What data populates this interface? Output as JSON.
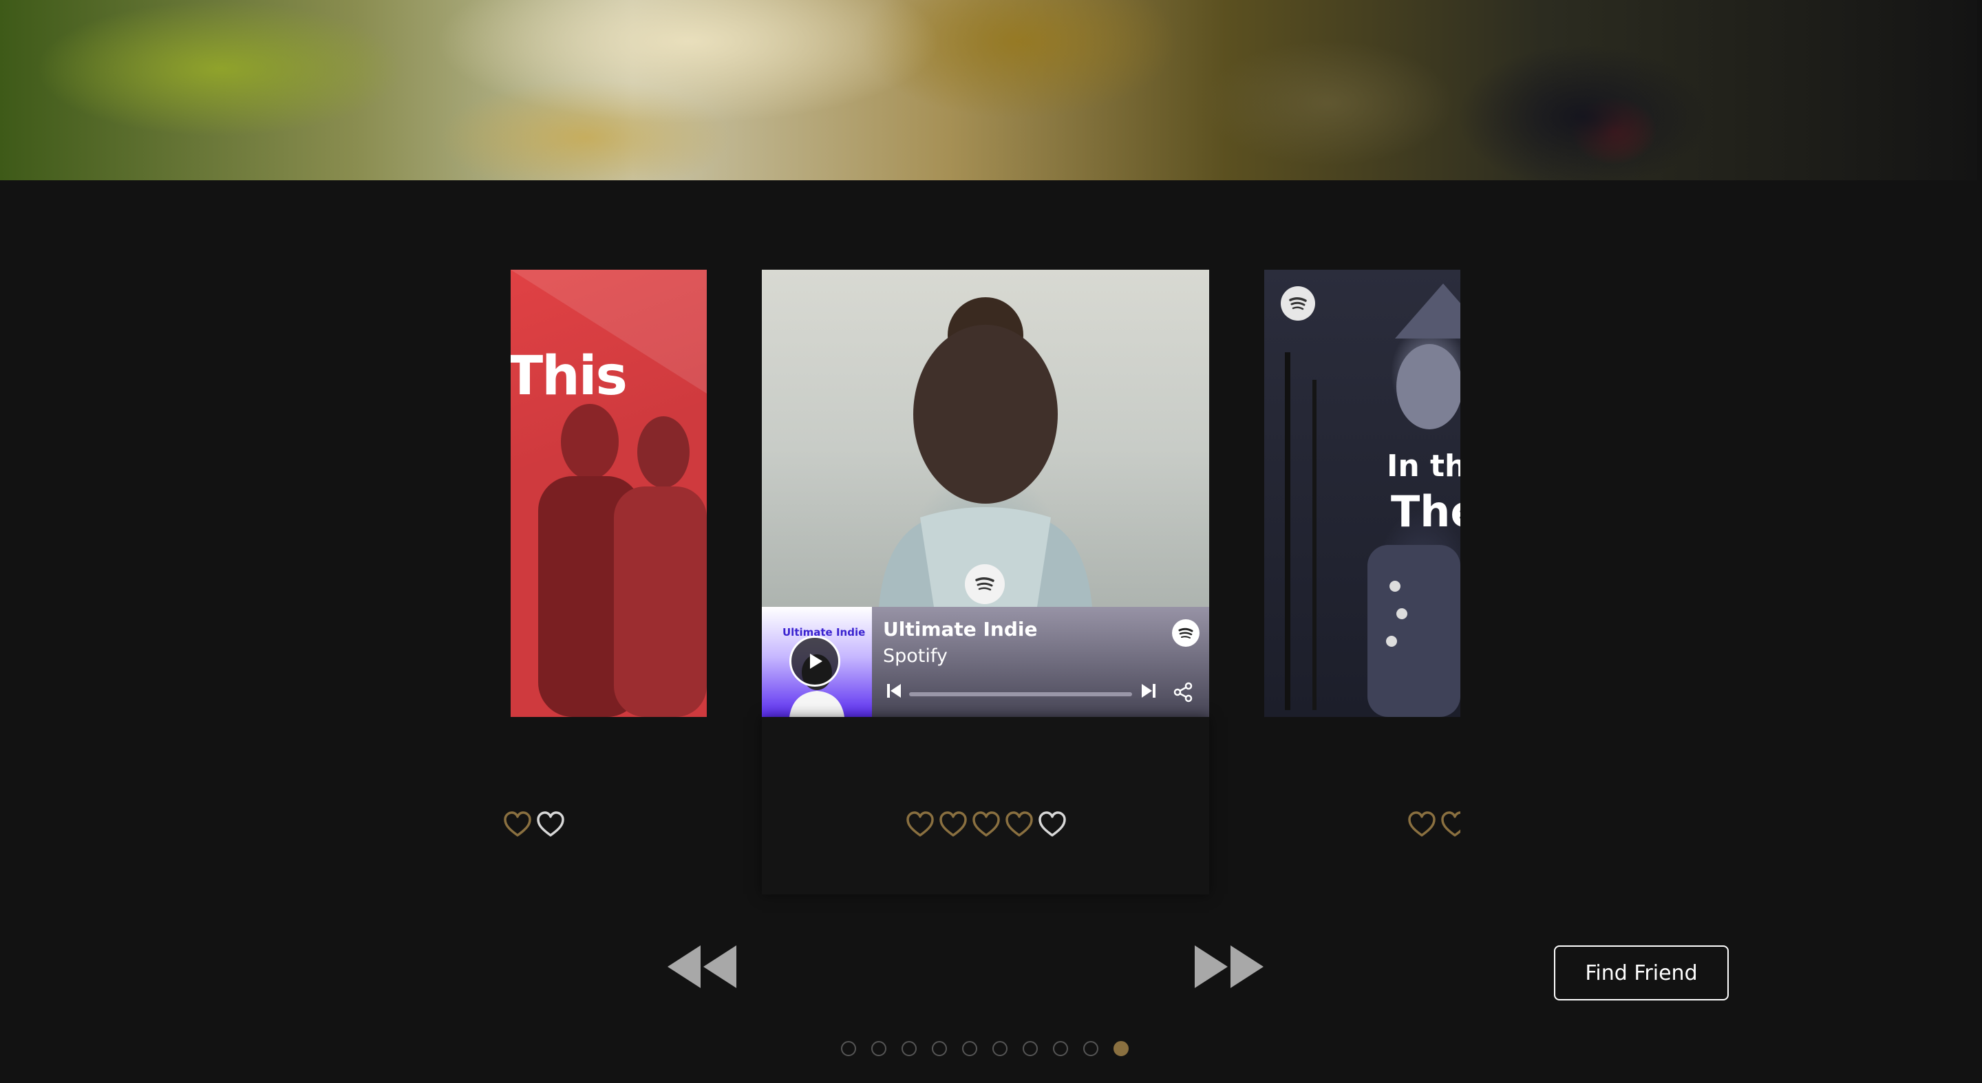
{
  "carousel": {
    "left_card": {
      "title_fragment": "This"
    },
    "center_card": {
      "cover_title": "Ultimate Indie",
      "track_title": "Ultimate Indie",
      "track_artist": "Spotify",
      "progress": 0
    },
    "right_card": {
      "line1": "In the",
      "line2": "The"
    }
  },
  "ratings": {
    "left": {
      "filled": 1,
      "total": 2
    },
    "center": {
      "filled": 4,
      "total": 5
    },
    "right": {
      "filled": 2,
      "total": 2
    }
  },
  "controls": {
    "find_friend_label": "Find Friend"
  },
  "pagination": {
    "count": 10,
    "active_index": 9
  },
  "colors": {
    "background": "#121212",
    "heart_filled": "#8a7040",
    "heart_empty": "#d8d8d8",
    "dot_active": "#8a7040",
    "dot_inactive": "#555555",
    "spotify_green": "#1db954"
  },
  "icons": [
    "spotify-icon",
    "play-icon",
    "skip-previous-icon",
    "skip-next-icon",
    "share-icon",
    "heart-icon",
    "rewind-icon",
    "fast-forward-icon"
  ]
}
